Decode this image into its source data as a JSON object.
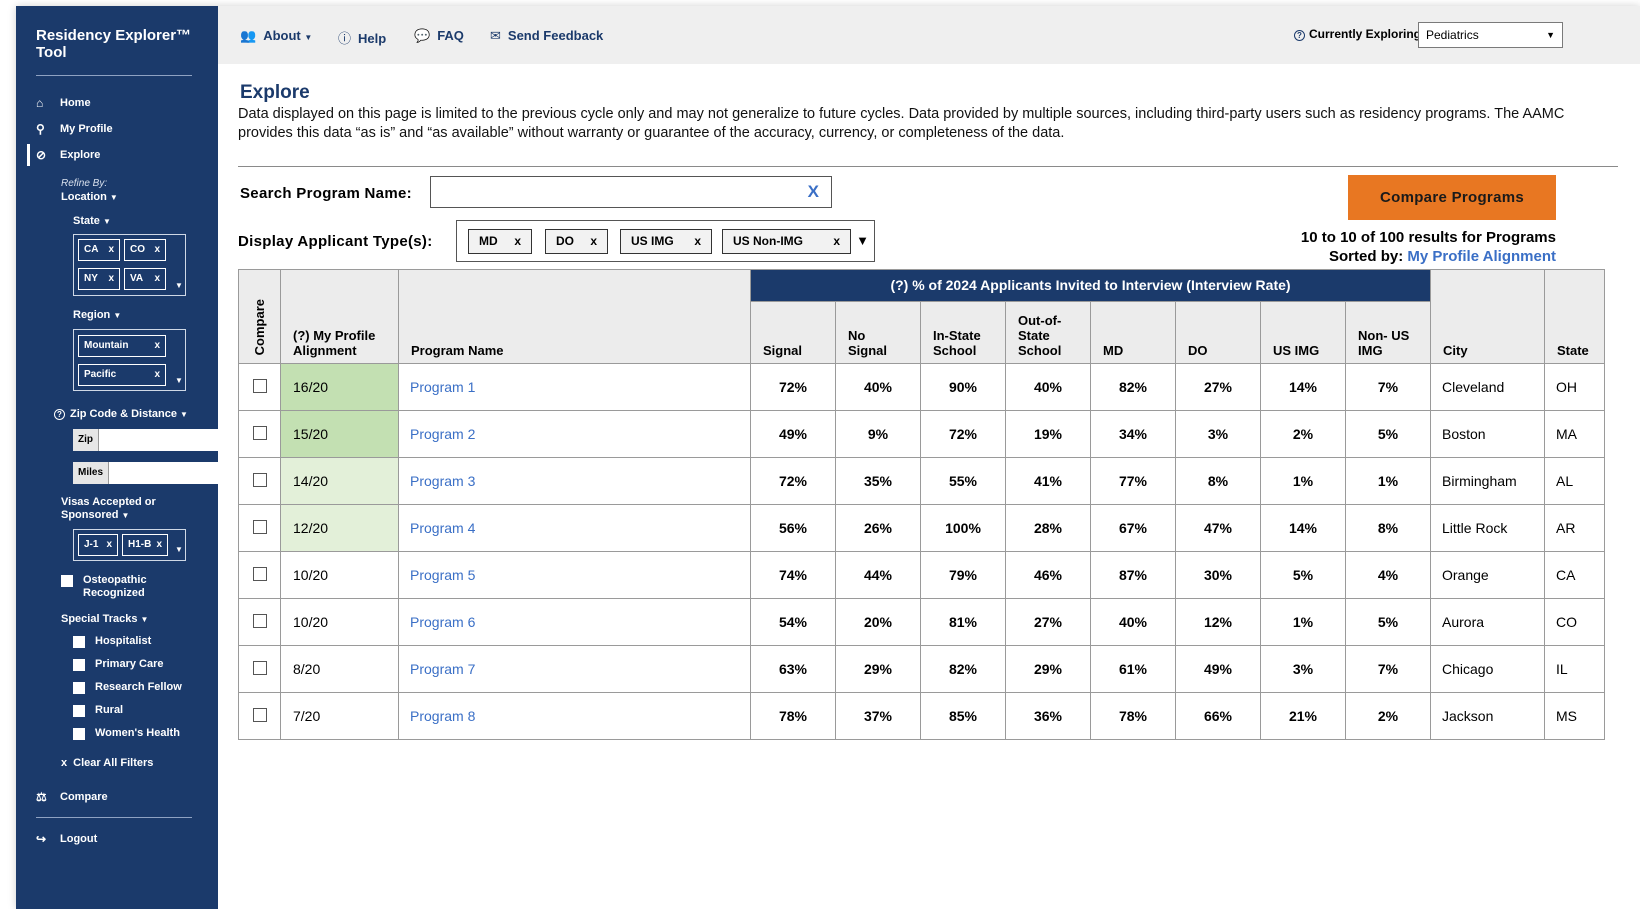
{
  "app": {
    "title": "Residency Explorer™ Tool"
  },
  "colors": {
    "sidebar": "#1b3a6b",
    "accent_orange": "#e87722",
    "link_blue": "#3a6fc6",
    "alignment_high": "#c3e0b2",
    "alignment_mid": "#e3f0d9"
  },
  "sidebar": {
    "nav": {
      "home": "Home",
      "profile": "My Profile",
      "explore": "Explore",
      "compare": "Compare",
      "logout": "Logout"
    },
    "refine_by": "Refine By:",
    "location_label": "Location",
    "state_label": "State",
    "states": [
      "CA",
      "CO",
      "NY",
      "VA"
    ],
    "region_label": "Region",
    "regions": [
      "Mountain",
      "Pacific"
    ],
    "zip_distance_label": "Zip Code & Distance",
    "zip_label": "Zip",
    "miles_label": "Miles",
    "visas_label_1": "Visas Accepted or",
    "visas_label_2": "Sponsored",
    "visas": [
      "J-1",
      "H1-B"
    ],
    "osteopathic_1": "Osteopathic",
    "osteopathic_2": "Recognized",
    "special_tracks_label": "Special Tracks",
    "tracks": [
      "Hospitalist",
      "Primary Care",
      "Research Fellow",
      "Rural",
      "Women's Health"
    ],
    "clear_all": "Clear All Filters",
    "chip_x": "x"
  },
  "topbar": {
    "about": "About",
    "help": "Help",
    "faq": "FAQ",
    "feedback": "Send Feedback",
    "exploring_label": "Currently Exploring:",
    "specialty": "Pediatrics"
  },
  "main": {
    "title": "Explore",
    "disclaimer": "Data displayed on this page is limited to the previous cycle only and may not generalize to future cycles. Data provided by multiple sources, including third-party users such as residency programs. The AAMC provides this data “as is” and “as available” without warranty or guarantee of the accuracy, currency, or completeness of the data.",
    "search_label": "Search Program Name:",
    "search_value": "",
    "search_clear": "X",
    "compare_button": "Compare Programs",
    "applicant_label": "Display Applicant Type(s):",
    "applicant_types": [
      "MD",
      "DO",
      "US IMG",
      "US Non-IMG"
    ],
    "results_line": "10 to 10 of 100 results for Programs",
    "sorted_by_label": "Sorted by:",
    "sorted_by_value": "My Profile Alignment"
  },
  "table": {
    "band": "(?) % of 2024 Applicants Invited to Interview (Interview Rate)",
    "headers": {
      "compare": "Compare",
      "alignment_1": "(?) My Profile",
      "alignment_2": "Alignment",
      "program": "Program Name",
      "signal": "Signal",
      "nosignal_1": "No",
      "nosignal_2": "Signal",
      "instate_1": "In-State",
      "instate_2": "School",
      "outstate_1": "Out-of-",
      "outstate_2": "State",
      "outstate_3": "School",
      "md": "MD",
      "do": "DO",
      "usimg": "US IMG",
      "nonusimg_1": "Non- US",
      "nonusimg_2": "IMG",
      "city": "City",
      "state": "State"
    },
    "rows": [
      {
        "alignment": "16/20",
        "program": "Program 1",
        "signal": "72%",
        "no_signal": "40%",
        "in_state": "90%",
        "out_state": "40%",
        "md": "82%",
        "do": "27%",
        "us_img": "14%",
        "non_us_img": "7%",
        "city": "Cleveland",
        "state": "OH"
      },
      {
        "alignment": "15/20",
        "program": "Program 2",
        "signal": "49%",
        "no_signal": "9%",
        "in_state": "72%",
        "out_state": "19%",
        "md": "34%",
        "do": "3%",
        "us_img": "2%",
        "non_us_img": "5%",
        "city": "Boston",
        "state": "MA"
      },
      {
        "alignment": "14/20",
        "program": "Program 3",
        "signal": "72%",
        "no_signal": "35%",
        "in_state": "55%",
        "out_state": "41%",
        "md": "77%",
        "do": "8%",
        "us_img": "1%",
        "non_us_img": "1%",
        "city": "Birmingham",
        "state": "AL"
      },
      {
        "alignment": "12/20",
        "program": "Program 4",
        "signal": "56%",
        "no_signal": "26%",
        "in_state": "100%",
        "out_state": "28%",
        "md": "67%",
        "do": "47%",
        "us_img": "14%",
        "non_us_img": "8%",
        "city": "Little Rock",
        "state": "AR"
      },
      {
        "alignment": "10/20",
        "program": "Program 5",
        "signal": "74%",
        "no_signal": "44%",
        "in_state": "79%",
        "out_state": "46%",
        "md": "87%",
        "do": "30%",
        "us_img": "5%",
        "non_us_img": "4%",
        "city": "Orange",
        "state": "CA"
      },
      {
        "alignment": "10/20",
        "program": "Program 6",
        "signal": "54%",
        "no_signal": "20%",
        "in_state": "81%",
        "out_state": "27%",
        "md": "40%",
        "do": "12%",
        "us_img": "1%",
        "non_us_img": "5%",
        "city": "Aurora",
        "state": "CO"
      },
      {
        "alignment": "8/20",
        "program": "Program 7",
        "signal": "63%",
        "no_signal": "29%",
        "in_state": "82%",
        "out_state": "29%",
        "md": "61%",
        "do": "49%",
        "us_img": "3%",
        "non_us_img": "7%",
        "city": "Chicago",
        "state": "IL"
      },
      {
        "alignment": "7/20",
        "program": "Program 8",
        "signal": "78%",
        "no_signal": "37%",
        "in_state": "85%",
        "out_state": "36%",
        "md": "78%",
        "do": "66%",
        "us_img": "21%",
        "non_us_img": "2%",
        "city": "Jackson",
        "state": "MS"
      }
    ]
  }
}
